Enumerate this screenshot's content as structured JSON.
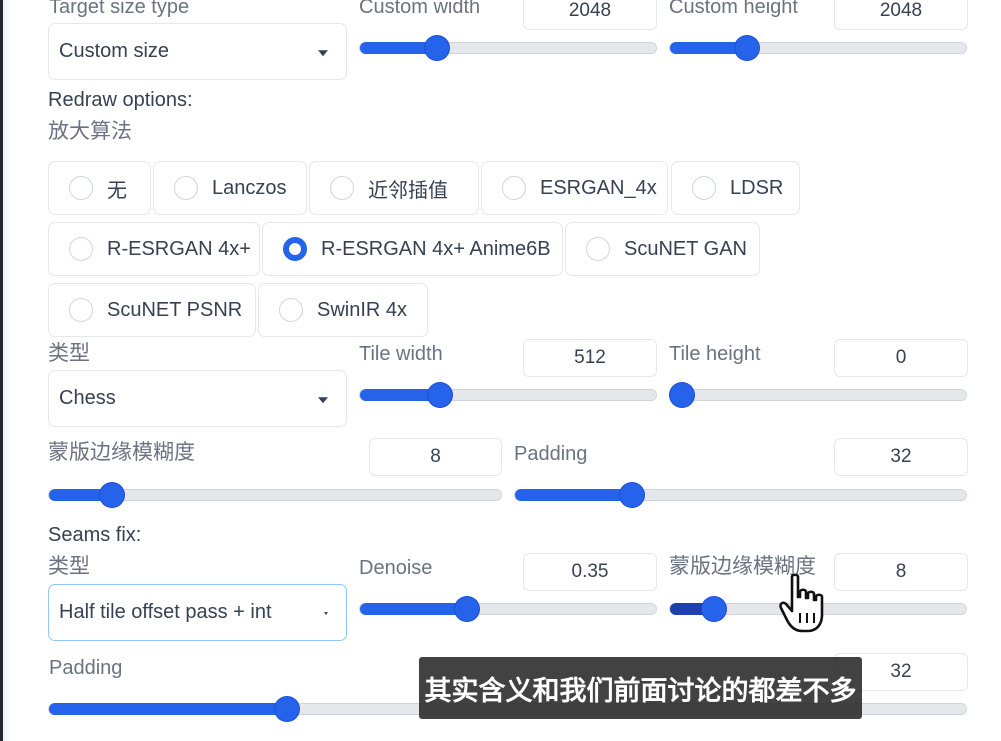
{
  "target": {
    "size_type_label": "Target size type",
    "size_type_value": "Custom size",
    "custom_width_label": "Custom width",
    "custom_width_value": "2048",
    "custom_width_fill": 0.26,
    "custom_height_label": "Custom height",
    "custom_height_value": "2048",
    "custom_height_fill": 0.26
  },
  "redraw": {
    "section_label": "Redraw options:",
    "upscaler_label": "放大算法",
    "upscaler_options": [
      {
        "label": "无",
        "checked": false
      },
      {
        "label": "Lanczos",
        "checked": false
      },
      {
        "label": "近邻插值",
        "checked": false
      },
      {
        "label": "ESRGAN_4x",
        "checked": false
      },
      {
        "label": "LDSR",
        "checked": false
      },
      {
        "label": "R-ESRGAN 4x+",
        "checked": false
      },
      {
        "label": "R-ESRGAN 4x+ Anime6B",
        "checked": true
      },
      {
        "label": "ScuNET GAN",
        "checked": false
      },
      {
        "label": "ScuNET PSNR",
        "checked": false
      },
      {
        "label": "SwinIR 4x",
        "checked": false
      }
    ],
    "type_label": "类型",
    "type_value": "Chess",
    "tile_width_label": "Tile width",
    "tile_width_value": "512",
    "tile_width_fill": 0.27,
    "tile_height_label": "Tile height",
    "tile_height_value": "0",
    "tile_height_fill": 0.04,
    "mask_blur_label": "蒙版边缘模糊度",
    "mask_blur_value": "8",
    "mask_blur_fill": 0.14,
    "padding_label": "Padding",
    "padding_value": "32",
    "padding_fill": 0.26
  },
  "seams": {
    "section_label": "Seams fix:",
    "type_label": "类型",
    "type_value": "Half tile offset pass + int",
    "denoise_label": "Denoise",
    "denoise_value": "0.35",
    "denoise_fill": 0.36,
    "mask_blur_label": "蒙版边缘模糊度",
    "mask_blur_value": "8",
    "mask_blur_fill": 0.15,
    "padding_label": "Padding",
    "padding_value": "32",
    "padding_fill": 0.26
  },
  "subtitle": "其实含义和我们前面讨论的都差不多",
  "colors": {
    "accent": "#2563eb",
    "border": "#e5e7eb",
    "label": "#6b7280"
  }
}
